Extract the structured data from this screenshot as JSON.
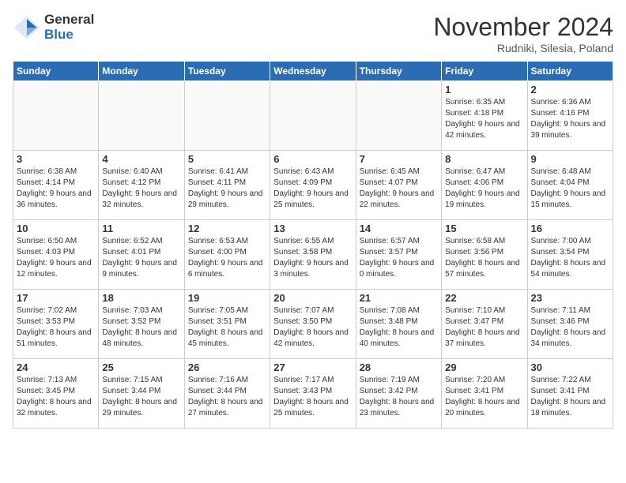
{
  "logo": {
    "general": "General",
    "blue": "Blue"
  },
  "title": "November 2024",
  "location": "Rudniki, Silesia, Poland",
  "days_of_week": [
    "Sunday",
    "Monday",
    "Tuesday",
    "Wednesday",
    "Thursday",
    "Friday",
    "Saturday"
  ],
  "weeks": [
    [
      {
        "day": "",
        "empty": true
      },
      {
        "day": "",
        "empty": true
      },
      {
        "day": "",
        "empty": true
      },
      {
        "day": "",
        "empty": true
      },
      {
        "day": "",
        "empty": true
      },
      {
        "day": "1",
        "sunrise": "6:35 AM",
        "sunset": "4:18 PM",
        "daylight": "9 hours and 42 minutes."
      },
      {
        "day": "2",
        "sunrise": "6:36 AM",
        "sunset": "4:16 PM",
        "daylight": "9 hours and 39 minutes."
      }
    ],
    [
      {
        "day": "3",
        "sunrise": "6:38 AM",
        "sunset": "4:14 PM",
        "daylight": "9 hours and 36 minutes."
      },
      {
        "day": "4",
        "sunrise": "6:40 AM",
        "sunset": "4:12 PM",
        "daylight": "9 hours and 32 minutes."
      },
      {
        "day": "5",
        "sunrise": "6:41 AM",
        "sunset": "4:11 PM",
        "daylight": "9 hours and 29 minutes."
      },
      {
        "day": "6",
        "sunrise": "6:43 AM",
        "sunset": "4:09 PM",
        "daylight": "9 hours and 25 minutes."
      },
      {
        "day": "7",
        "sunrise": "6:45 AM",
        "sunset": "4:07 PM",
        "daylight": "9 hours and 22 minutes."
      },
      {
        "day": "8",
        "sunrise": "6:47 AM",
        "sunset": "4:06 PM",
        "daylight": "9 hours and 19 minutes."
      },
      {
        "day": "9",
        "sunrise": "6:48 AM",
        "sunset": "4:04 PM",
        "daylight": "9 hours and 15 minutes."
      }
    ],
    [
      {
        "day": "10",
        "sunrise": "6:50 AM",
        "sunset": "4:03 PM",
        "daylight": "9 hours and 12 minutes."
      },
      {
        "day": "11",
        "sunrise": "6:52 AM",
        "sunset": "4:01 PM",
        "daylight": "9 hours and 9 minutes."
      },
      {
        "day": "12",
        "sunrise": "6:53 AM",
        "sunset": "4:00 PM",
        "daylight": "9 hours and 6 minutes."
      },
      {
        "day": "13",
        "sunrise": "6:55 AM",
        "sunset": "3:58 PM",
        "daylight": "9 hours and 3 minutes."
      },
      {
        "day": "14",
        "sunrise": "6:57 AM",
        "sunset": "3:57 PM",
        "daylight": "9 hours and 0 minutes."
      },
      {
        "day": "15",
        "sunrise": "6:58 AM",
        "sunset": "3:56 PM",
        "daylight": "8 hours and 57 minutes."
      },
      {
        "day": "16",
        "sunrise": "7:00 AM",
        "sunset": "3:54 PM",
        "daylight": "8 hours and 54 minutes."
      }
    ],
    [
      {
        "day": "17",
        "sunrise": "7:02 AM",
        "sunset": "3:53 PM",
        "daylight": "8 hours and 51 minutes."
      },
      {
        "day": "18",
        "sunrise": "7:03 AM",
        "sunset": "3:52 PM",
        "daylight": "8 hours and 48 minutes."
      },
      {
        "day": "19",
        "sunrise": "7:05 AM",
        "sunset": "3:51 PM",
        "daylight": "8 hours and 45 minutes."
      },
      {
        "day": "20",
        "sunrise": "7:07 AM",
        "sunset": "3:50 PM",
        "daylight": "8 hours and 42 minutes."
      },
      {
        "day": "21",
        "sunrise": "7:08 AM",
        "sunset": "3:48 PM",
        "daylight": "8 hours and 40 minutes."
      },
      {
        "day": "22",
        "sunrise": "7:10 AM",
        "sunset": "3:47 PM",
        "daylight": "8 hours and 37 minutes."
      },
      {
        "day": "23",
        "sunrise": "7:11 AM",
        "sunset": "3:46 PM",
        "daylight": "8 hours and 34 minutes."
      }
    ],
    [
      {
        "day": "24",
        "sunrise": "7:13 AM",
        "sunset": "3:45 PM",
        "daylight": "8 hours and 32 minutes."
      },
      {
        "day": "25",
        "sunrise": "7:15 AM",
        "sunset": "3:44 PM",
        "daylight": "8 hours and 29 minutes."
      },
      {
        "day": "26",
        "sunrise": "7:16 AM",
        "sunset": "3:44 PM",
        "daylight": "8 hours and 27 minutes."
      },
      {
        "day": "27",
        "sunrise": "7:17 AM",
        "sunset": "3:43 PM",
        "daylight": "8 hours and 25 minutes."
      },
      {
        "day": "28",
        "sunrise": "7:19 AM",
        "sunset": "3:42 PM",
        "daylight": "8 hours and 23 minutes."
      },
      {
        "day": "29",
        "sunrise": "7:20 AM",
        "sunset": "3:41 PM",
        "daylight": "8 hours and 20 minutes."
      },
      {
        "day": "30",
        "sunrise": "7:22 AM",
        "sunset": "3:41 PM",
        "daylight": "8 hours and 18 minutes."
      }
    ]
  ]
}
